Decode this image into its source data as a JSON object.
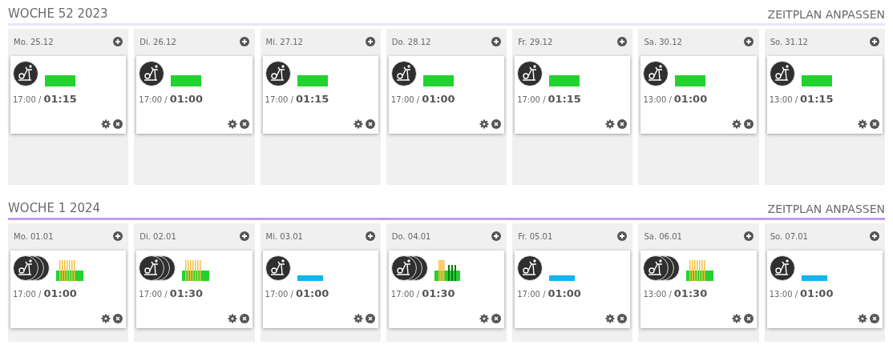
{
  "weeks": [
    {
      "title": "WOCHE 52 2023",
      "action": "ZEITPLAN ANPASSEN",
      "current": false,
      "days": [
        {
          "label": "Mo. 25.12",
          "workouts": [
            {
              "multiple": false,
              "kind": "steady",
              "start": "17:00 /",
              "duration": "01:15"
            }
          ]
        },
        {
          "label": "Di. 26.12",
          "workouts": [
            {
              "multiple": false,
              "kind": "steady",
              "start": "17:00 /",
              "duration": "01:00"
            }
          ]
        },
        {
          "label": "Mi. 27.12",
          "workouts": [
            {
              "multiple": false,
              "kind": "steady",
              "start": "17:00 /",
              "duration": "01:15"
            }
          ]
        },
        {
          "label": "Do. 28.12",
          "workouts": [
            {
              "multiple": false,
              "kind": "steady",
              "start": "17:00 /",
              "duration": "01:00"
            }
          ]
        },
        {
          "label": "Fr. 29.12",
          "workouts": [
            {
              "multiple": false,
              "kind": "steady",
              "start": "17:00 /",
              "duration": "01:15"
            }
          ]
        },
        {
          "label": "Sa. 30.12",
          "workouts": [
            {
              "multiple": false,
              "kind": "steady",
              "start": "13:00 /",
              "duration": "01:00"
            }
          ]
        },
        {
          "label": "So. 31.12",
          "workouts": [
            {
              "multiple": false,
              "kind": "steady",
              "start": "13:00 /",
              "duration": "01:15"
            }
          ]
        }
      ]
    },
    {
      "title": "WOCHE 1 2024",
      "action": "ZEITPLAN ANPASSEN",
      "current": true,
      "days": [
        {
          "label": "Mo. 01.01",
          "workouts": [
            {
              "multiple": true,
              "kind": "intervals",
              "start": "17:00 /",
              "duration": "01:00"
            }
          ]
        },
        {
          "label": "Di. 02.01",
          "workouts": [
            {
              "multiple": true,
              "kind": "intervals",
              "start": "17:00 /",
              "duration": "01:30"
            }
          ]
        },
        {
          "label": "Mi. 03.01",
          "workouts": [
            {
              "multiple": false,
              "kind": "easy",
              "start": "17:00 /",
              "duration": "01:00"
            }
          ]
        },
        {
          "label": "Do. 04.01",
          "workouts": [
            {
              "multiple": true,
              "kind": "threshold",
              "start": "17:00 /",
              "duration": "01:30"
            }
          ]
        },
        {
          "label": "Fr. 05.01",
          "workouts": [
            {
              "multiple": false,
              "kind": "easy",
              "start": "17:00 /",
              "duration": "01:00"
            }
          ]
        },
        {
          "label": "Sa. 06.01",
          "workouts": [
            {
              "multiple": true,
              "kind": "intervals",
              "start": "13:00 /",
              "duration": "01:30"
            }
          ]
        },
        {
          "label": "So. 07.01",
          "workouts": [
            {
              "multiple": false,
              "kind": "easy",
              "start": "13:00 /",
              "duration": "01:00"
            }
          ]
        }
      ]
    }
  ]
}
